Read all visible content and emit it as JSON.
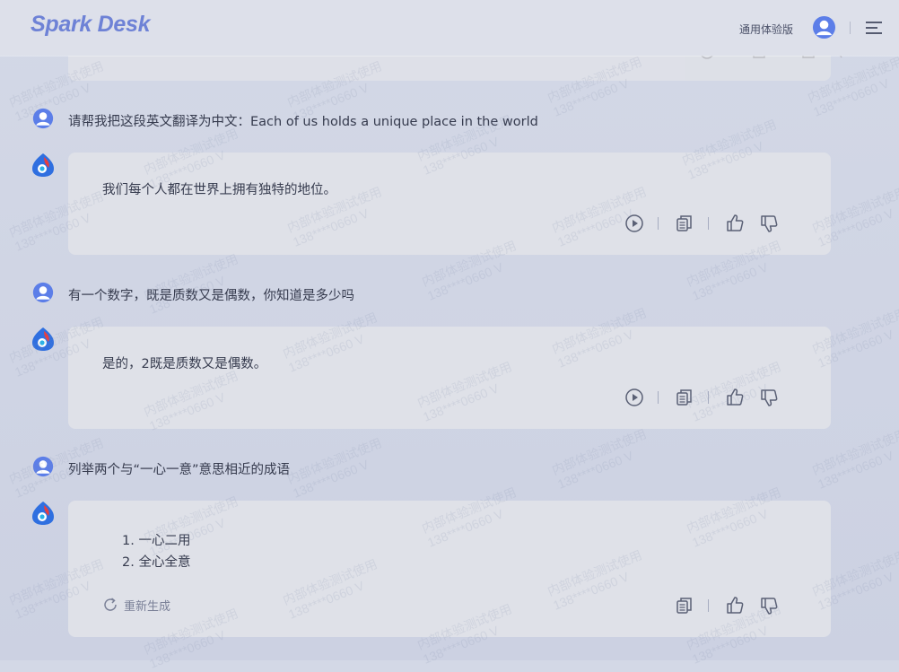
{
  "app": {
    "logo": "Spark Desk",
    "edition_label": "通用体验版"
  },
  "conversation": [
    {
      "user_text": "请帮我把这段英文翻译为中文：Each of us holds a unique place in the world",
      "answer": "我们每个人都在世界上拥有独特的地位。"
    },
    {
      "user_text": "有一个数字，既是质数又是偶数，你知道是多少吗",
      "answer": "是的，2既是质数又是偶数。"
    },
    {
      "user_text": "列举两个与“一心一意”意思相近的成语",
      "answer_list": [
        "1. 一心二用",
        "2. 全心全意"
      ],
      "regenerate_label": "重新生成"
    }
  ],
  "watermark": {
    "line1": "内部体验测试使用",
    "line2": "138****0660 V"
  },
  "colors": {
    "brand": "#6e82d6",
    "card_bg": "#dfe1e8",
    "page_bg": "#d3d8e6"
  },
  "icons": [
    "user-avatar-icon",
    "spark-bot-icon",
    "play-icon",
    "copy-icon",
    "thumbs-up-icon",
    "thumbs-down-icon",
    "refresh-icon",
    "menu-icon"
  ]
}
